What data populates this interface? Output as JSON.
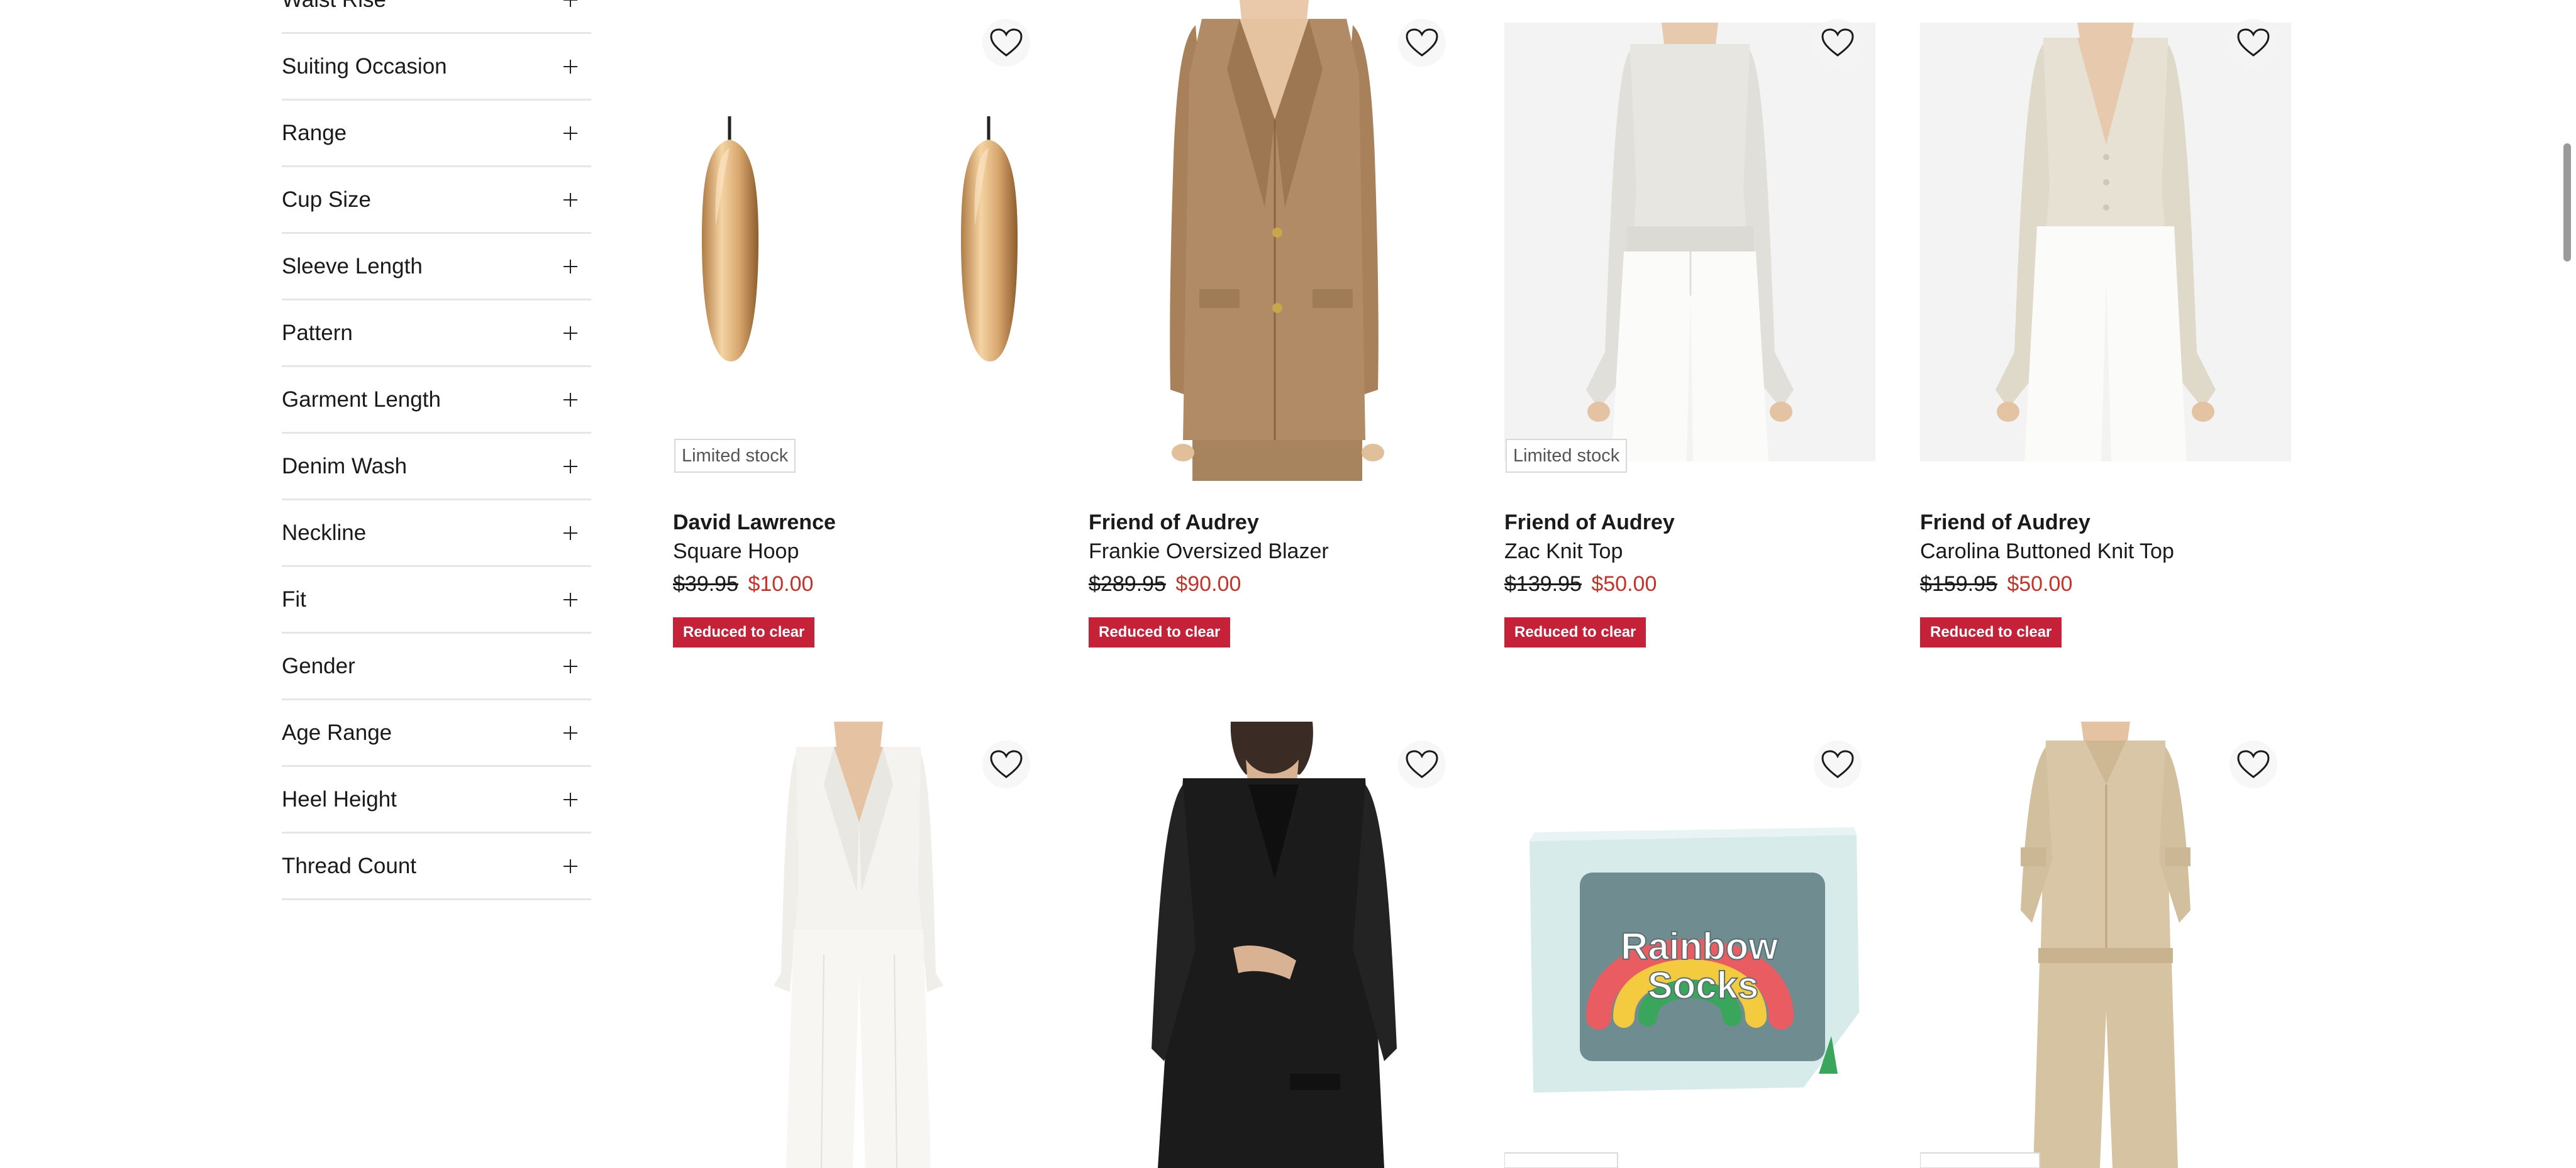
{
  "filters": [
    {
      "label": "Waist Rise"
    },
    {
      "label": "Suiting Occasion"
    },
    {
      "label": "Range"
    },
    {
      "label": "Cup Size"
    },
    {
      "label": "Sleeve Length"
    },
    {
      "label": "Pattern"
    },
    {
      "label": "Garment Length"
    },
    {
      "label": "Denim Wash"
    },
    {
      "label": "Neckline"
    },
    {
      "label": "Fit"
    },
    {
      "label": "Gender"
    },
    {
      "label": "Age Range"
    },
    {
      "label": "Heel Height"
    },
    {
      "label": "Thread Count"
    }
  ],
  "products": [
    {
      "brand": "David Lawrence",
      "name": "Square Hoop",
      "price_original": "$39.95",
      "price_sale": "$10.00",
      "tag": "Reduced to clear",
      "badge": "Limited stock"
    },
    {
      "brand": "Friend of Audrey",
      "name": "Frankie Oversized Blazer",
      "price_original": "$289.95",
      "price_sale": "$90.00",
      "tag": "Reduced to clear"
    },
    {
      "brand": "Friend of Audrey",
      "name": "Zac Knit Top",
      "price_original": "$139.95",
      "price_sale": "$50.00",
      "tag": "Reduced to clear",
      "badge": "Limited stock"
    },
    {
      "brand": "Friend of Audrey",
      "name": "Carolina Buttoned Knit Top",
      "price_original": "$159.95",
      "price_sale": "$50.00",
      "tag": "Reduced to clear"
    }
  ],
  "product_art": {
    "socks_box_line1": "Rainbow",
    "socks_box_line2": "Socks"
  },
  "colors": {
    "sale_price": "#c73229",
    "promo_tag": "#c5223a",
    "divider": "#e6e6e6"
  },
  "icons": {
    "wishlist": "heart-outline-icon",
    "expand": "plus-icon"
  }
}
